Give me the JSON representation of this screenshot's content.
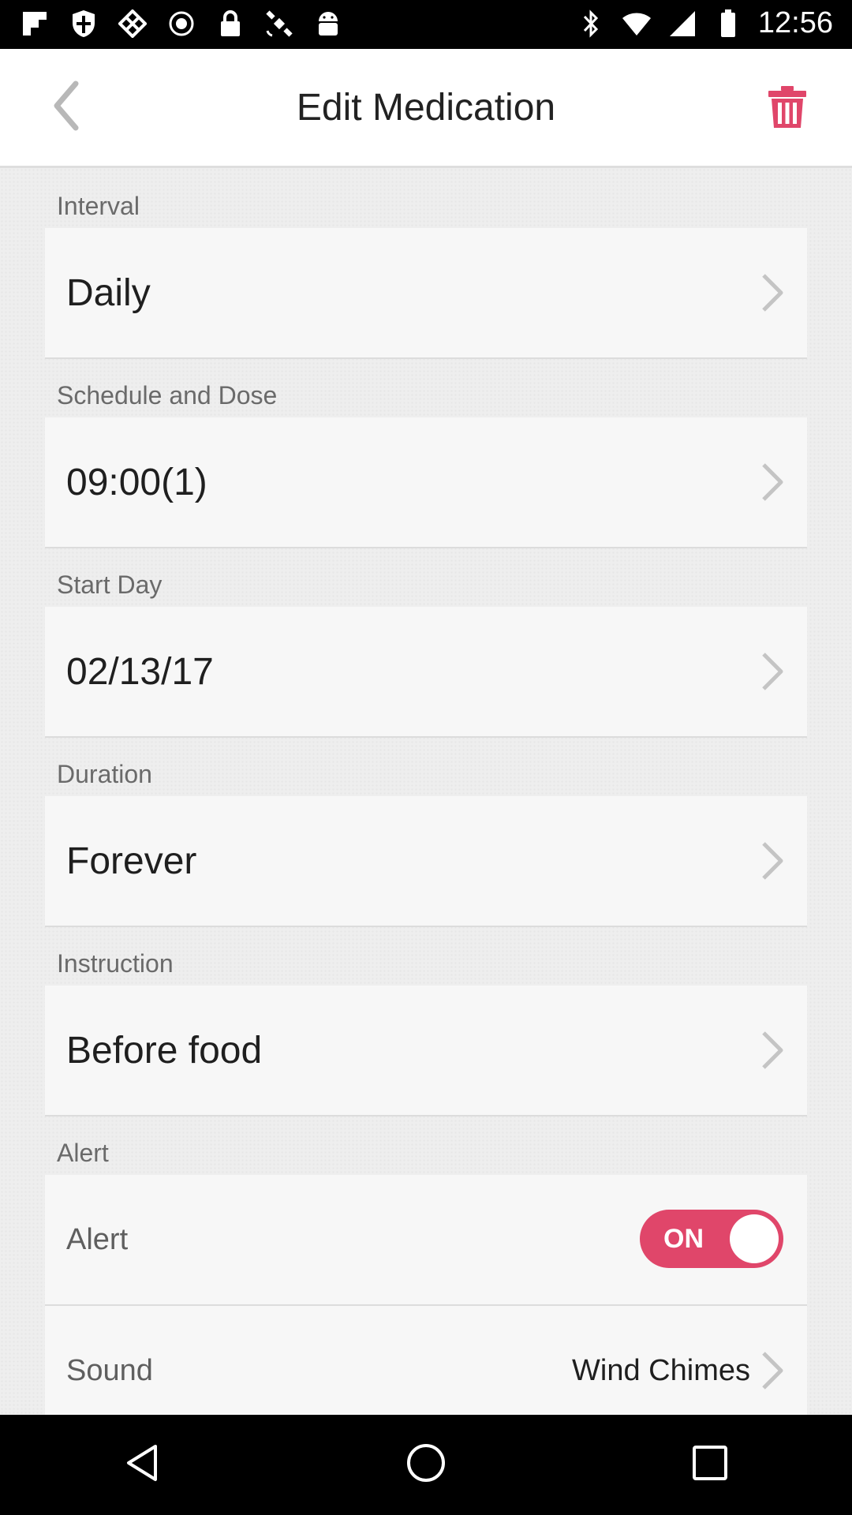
{
  "status_bar": {
    "time": "12:56",
    "left_icons": [
      "flipboard-icon",
      "shield-icon",
      "diamond-app-icon",
      "record-icon",
      "lock-icon",
      "satellite-icon",
      "android-icon"
    ],
    "right_icons": [
      "bluetooth-icon",
      "wifi-icon",
      "signal-icon",
      "battery-icon"
    ]
  },
  "header": {
    "title": "Edit Medication",
    "back_icon": "chevron-left-icon",
    "delete_icon": "trash-icon",
    "accent_color": "#e0466a"
  },
  "sections": {
    "interval": {
      "label": "Interval",
      "value": "Daily"
    },
    "schedule": {
      "label": "Schedule and Dose",
      "value": "09:00(1)"
    },
    "start_day": {
      "label": "Start Day",
      "value": "02/13/17"
    },
    "duration": {
      "label": "Duration",
      "value": "Forever"
    },
    "instruction": {
      "label": "Instruction",
      "value": "Before food"
    },
    "alert": {
      "label": "Alert",
      "alert_row_label": "Alert",
      "toggle_text": "ON",
      "toggle_on": true,
      "sound_label": "Sound",
      "sound_value": "Wind Chimes"
    }
  },
  "nav_bar": {
    "back": "nav-back-icon",
    "home": "nav-home-icon",
    "recents": "nav-recents-icon"
  }
}
